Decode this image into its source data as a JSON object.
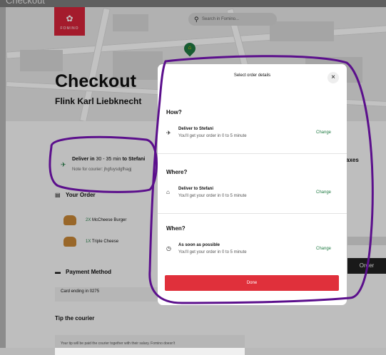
{
  "window": {
    "tab_title": "Checkout"
  },
  "brand": {
    "logo_text": "FOMINO",
    "accent": "#d8243a",
    "green": "#1f7a42"
  },
  "search": {
    "placeholder": "Search in Fomino..."
  },
  "page": {
    "title": "Checkout",
    "store": "Flink Karl Liebknecht",
    "delivery": {
      "prefix": "Deliver in",
      "time": "30 - 35 min",
      "to_word": "to",
      "name": "Stefani",
      "note": "Note for courier: jhgfuysdgfhagj"
    },
    "order": {
      "title": "Your Order",
      "items": [
        {
          "qty": "2X",
          "name": "McCheese Burger"
        },
        {
          "qty": "1X",
          "name": "Triple Cheese"
        }
      ]
    },
    "payment": {
      "title": "Payment Method",
      "card": "Card ending in 0275"
    },
    "tip": {
      "title": "Tip the courier",
      "text": "Your tip will be paid the courier together with their salary. Fomino doesn't"
    },
    "right": {
      "taxes_label": "axes",
      "order_button": "Order"
    }
  },
  "modal": {
    "title": "Select order details",
    "sections": [
      {
        "heading": "How?",
        "icon": "scooter-icon",
        "name": "Deliver to Stefani",
        "sub": "You'll get your order in 0 to 5 minute",
        "action": "Change"
      },
      {
        "heading": "Where?",
        "icon": "home-icon",
        "name": "Deliver to Stefani",
        "sub": "You'll get your order in 0 to 5 minute",
        "action": "Change"
      },
      {
        "heading": "When?",
        "icon": "clock-icon",
        "name": "As soon as possible",
        "sub": "You'll get your order in 0 to 5 minute",
        "action": "Change"
      }
    ],
    "done_label": "Done"
  },
  "annotation": {
    "stroke_color": "#5b0f8c"
  }
}
